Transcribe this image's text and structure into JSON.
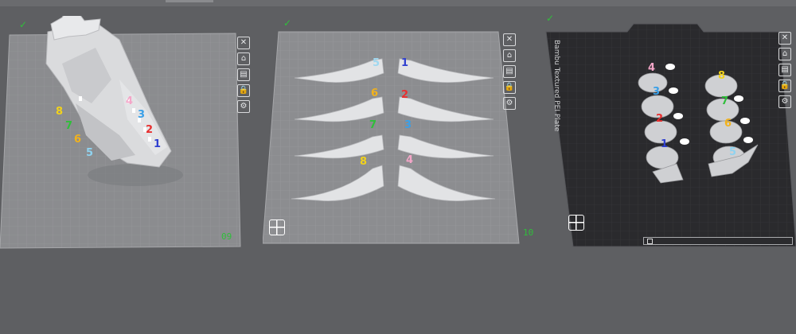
{
  "plates": [
    {
      "number": "09",
      "label": ""
    },
    {
      "number": "10",
      "label": ""
    },
    {
      "number": "",
      "label": "Bambu Textured PEI Plate"
    }
  ],
  "plate_toolbar": {
    "icons": [
      "close-icon",
      "auto-orient-icon",
      "arrange-icon",
      "lock-icon",
      "settings-icon"
    ],
    "glyphs": [
      "✕",
      "⌂",
      "▤",
      "🔒",
      "⚙"
    ]
  },
  "plate1_labels": [
    {
      "text": "8",
      "color": "#f2d21b"
    },
    {
      "text": "7",
      "color": "#2fbf3a"
    },
    {
      "text": "6",
      "color": "#f2b21b"
    },
    {
      "text": "5",
      "color": "#8fd3f0"
    },
    {
      "text": "4",
      "color": "#f4a6c8"
    },
    {
      "text": "3",
      "color": "#3aa0e8"
    },
    {
      "text": "2",
      "color": "#e83030"
    },
    {
      "text": "1",
      "color": "#3040d0"
    }
  ],
  "plate2_labels": [
    {
      "text": "5",
      "color": "#9fd8f0"
    },
    {
      "text": "1",
      "color": "#3040d0"
    },
    {
      "text": "6",
      "color": "#f2b21b"
    },
    {
      "text": "2",
      "color": "#e83030"
    },
    {
      "text": "7",
      "color": "#2fbf3a"
    },
    {
      "text": "3",
      "color": "#3aa0e8"
    },
    {
      "text": "8",
      "color": "#f2d21b"
    },
    {
      "text": "4",
      "color": "#f4a6c8"
    }
  ],
  "plate3_labels": [
    {
      "text": "4",
      "color": "#f4a6c8"
    },
    {
      "text": "8",
      "color": "#f2d21b"
    },
    {
      "text": "3",
      "color": "#3aa0e8"
    },
    {
      "text": "7",
      "color": "#2fbf3a"
    },
    {
      "text": "2",
      "color": "#e83030"
    },
    {
      "text": "6",
      "color": "#f2b21b"
    },
    {
      "text": "1",
      "color": "#3040d0"
    },
    {
      "text": "5",
      "color": "#8fd3f0"
    }
  ],
  "colors": {
    "background": "#5e5f62",
    "plate_light": "#8b8c8f",
    "plate_dark": "#2a2a2d",
    "accent_green": "#2fbf3a"
  }
}
